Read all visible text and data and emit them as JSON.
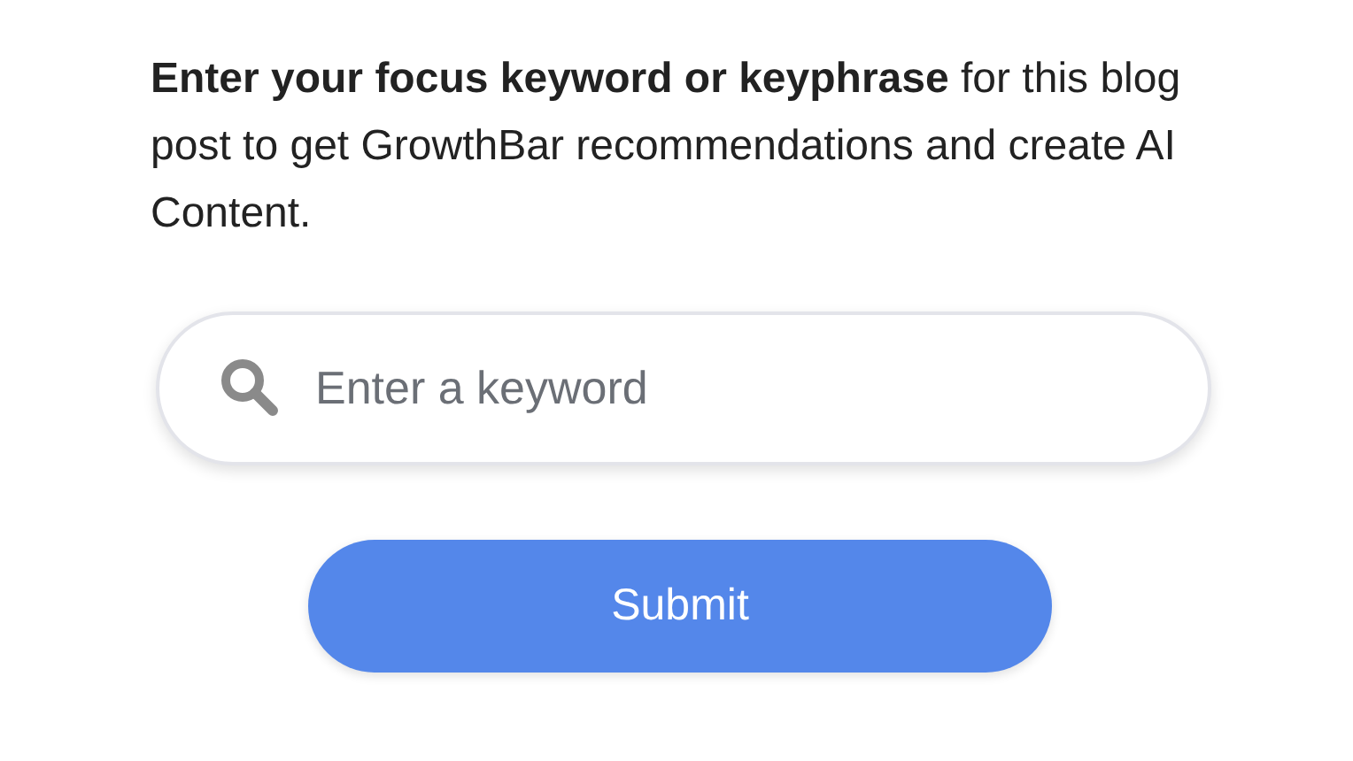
{
  "intro": "**Enter your focus keyword or keyphrase** for this blog post to get GrowthBar recommendations and create AI Content.",
  "search": {
    "placeholder": "Enter a keyword"
  },
  "submit_button": {
    "label": "Submit"
  }
}
